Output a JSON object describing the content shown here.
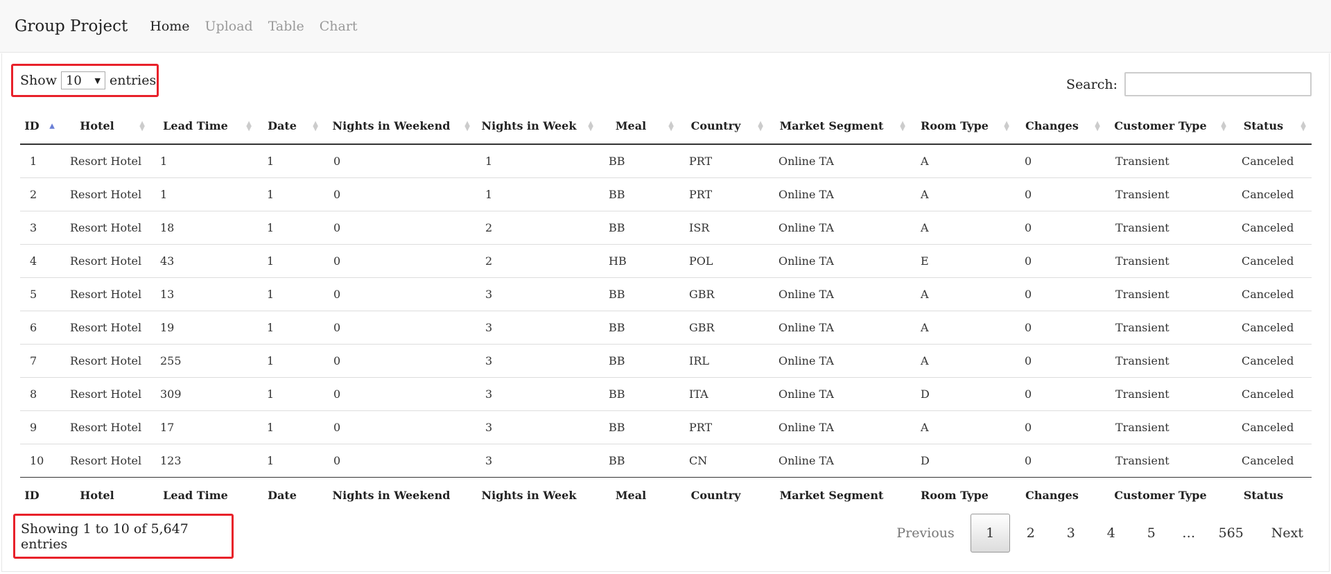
{
  "nav": {
    "brand": "Group Project",
    "items": [
      {
        "label": "Home"
      },
      {
        "label": "Upload"
      },
      {
        "label": "Table"
      },
      {
        "label": "Chart"
      }
    ]
  },
  "length_menu": {
    "prefix": "Show",
    "value": "10",
    "suffix": "entries"
  },
  "search": {
    "label": "Search:",
    "value": ""
  },
  "table": {
    "columns": [
      "ID",
      "Hotel",
      "Lead Time",
      "Date",
      "Nights in Weekend",
      "Nights in Week",
      "Meal",
      "Country",
      "Market Segment",
      "Room Type",
      "Changes",
      "Customer Type",
      "Status"
    ],
    "sorted_column": "ID",
    "sort_direction": "asc",
    "rows": [
      [
        "1",
        "Resort Hotel",
        "1",
        "1",
        "0",
        "1",
        "BB",
        "PRT",
        "Online TA",
        "A",
        "0",
        "Transient",
        "Canceled"
      ],
      [
        "2",
        "Resort Hotel",
        "1",
        "1",
        "0",
        "1",
        "BB",
        "PRT",
        "Online TA",
        "A",
        "0",
        "Transient",
        "Canceled"
      ],
      [
        "3",
        "Resort Hotel",
        "18",
        "1",
        "0",
        "2",
        "BB",
        "ISR",
        "Online TA",
        "A",
        "0",
        "Transient",
        "Canceled"
      ],
      [
        "4",
        "Resort Hotel",
        "43",
        "1",
        "0",
        "2",
        "HB",
        "POL",
        "Online TA",
        "E",
        "0",
        "Transient",
        "Canceled"
      ],
      [
        "5",
        "Resort Hotel",
        "13",
        "1",
        "0",
        "3",
        "BB",
        "GBR",
        "Online TA",
        "A",
        "0",
        "Transient",
        "Canceled"
      ],
      [
        "6",
        "Resort Hotel",
        "19",
        "1",
        "0",
        "3",
        "BB",
        "GBR",
        "Online TA",
        "A",
        "0",
        "Transient",
        "Canceled"
      ],
      [
        "7",
        "Resort Hotel",
        "255",
        "1",
        "0",
        "3",
        "BB",
        "IRL",
        "Online TA",
        "A",
        "0",
        "Transient",
        "Canceled"
      ],
      [
        "8",
        "Resort Hotel",
        "309",
        "1",
        "0",
        "3",
        "BB",
        "ITA",
        "Online TA",
        "D",
        "0",
        "Transient",
        "Canceled"
      ],
      [
        "9",
        "Resort Hotel",
        "17",
        "1",
        "0",
        "3",
        "BB",
        "PRT",
        "Online TA",
        "A",
        "0",
        "Transient",
        "Canceled"
      ],
      [
        "10",
        "Resort Hotel",
        "123",
        "1",
        "0",
        "3",
        "BB",
        "CN",
        "Online TA",
        "D",
        "0",
        "Transient",
        "Canceled"
      ]
    ]
  },
  "info": "Showing 1 to 10 of 5,647 entries",
  "pagination": {
    "previous": "Previous",
    "next": "Next",
    "pages": [
      "1",
      "2",
      "3",
      "4",
      "5",
      "…",
      "565"
    ],
    "current": "1"
  },
  "colors": {
    "highlight_border": "#e8212a",
    "sort_active": "#6a7fd6"
  }
}
